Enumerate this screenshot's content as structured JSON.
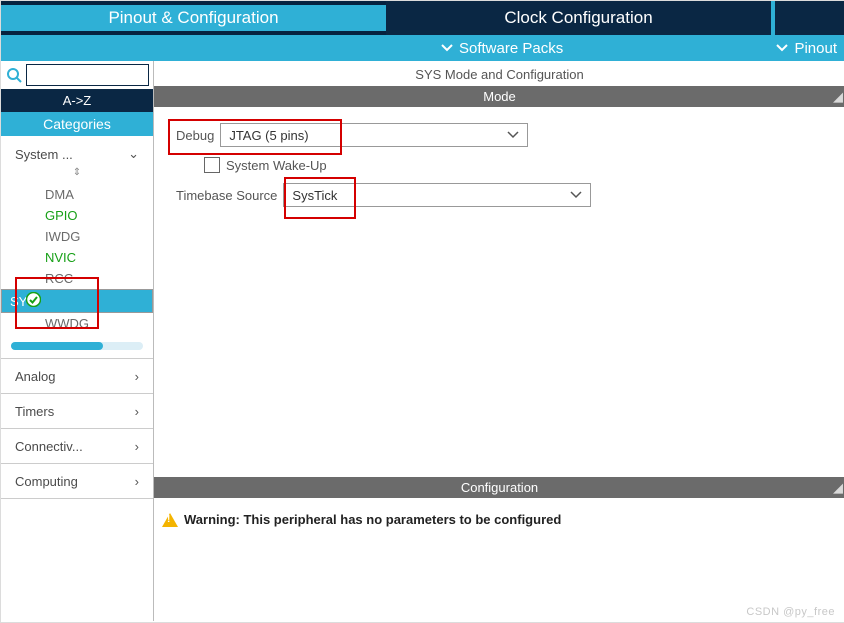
{
  "tabs": {
    "active": "Pinout & Configuration",
    "inactive": "Clock Configuration"
  },
  "subbar": {
    "mid": "Software Packs",
    "right": "Pinout"
  },
  "sidebar": {
    "sort": "A->Z",
    "categories_label": "Categories",
    "groups": [
      {
        "name": "System ...",
        "open": true,
        "items": [
          {
            "label": "DMA",
            "cls": ""
          },
          {
            "label": "GPIO",
            "cls": "green"
          },
          {
            "label": "IWDG",
            "cls": ""
          },
          {
            "label": "NVIC",
            "cls": "green"
          },
          {
            "label": "RCC",
            "cls": ""
          },
          {
            "label": "SYS",
            "cls": "green sel"
          },
          {
            "label": "WWDG",
            "cls": ""
          }
        ]
      },
      {
        "name": "Analog",
        "open": false
      },
      {
        "name": "Timers",
        "open": false
      },
      {
        "name": "Connectiv...",
        "open": false
      },
      {
        "name": "Computing",
        "open": false
      }
    ]
  },
  "main": {
    "title": "SYS Mode and Configuration",
    "mode_header": "Mode",
    "debug_label": "Debug",
    "debug_value": "JTAG (5 pins)",
    "wakeup_label": "System Wake-Up",
    "timebase_label": "Timebase Source",
    "timebase_value": "SysTick",
    "config_header": "Configuration",
    "warning": "Warning: This peripheral has no parameters to be configured"
  },
  "watermark": "CSDN @py_free"
}
